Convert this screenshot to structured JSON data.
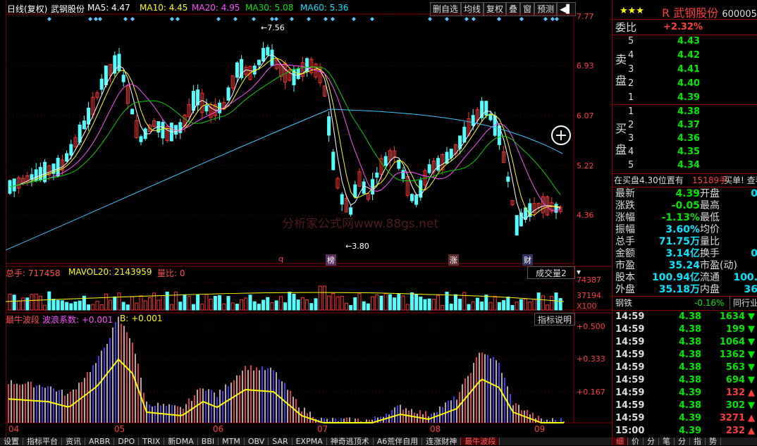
{
  "toolbar": {
    "mode": "日线(复权)",
    "stock": "武钢股份",
    "ma5": "MA5: 4.47",
    "ma10": "MA10: 4.45",
    "ma20": "MA20: 4.95",
    "ma30": "MA30: 5.08",
    "ma60": "MA60: 5.36",
    "buttons": [
      "删自选",
      "均线",
      "复权",
      "叠",
      "窗",
      "预测"
    ]
  },
  "price_axis": [
    "7.77",
    "6.93",
    "6.07",
    "5.22",
    "4.36"
  ],
  "price_annotations": {
    "high": "7.56",
    "low": "3.80"
  },
  "event_markers": [
    "q",
    "榜",
    "涨",
    "财"
  ],
  "watermark": "分析家公式网www.88gs.net",
  "volume_header": {
    "total": "总手: 717458",
    "mavol": "MAVOL20: 2143959",
    "ratio": "量比: 0",
    "selector": "成交量2"
  },
  "volume_axis": [
    "74387",
    "37194",
    "X100"
  ],
  "indicator_header": {
    "name": "最牛波段",
    "coef": "波浪系数: +0.001",
    "b": "B: +0.001",
    "help": "指标说明"
  },
  "indicator_axis": [
    "+0.500",
    "+0.333",
    "+0.167"
  ],
  "dates": [
    "04",
    "05",
    "06",
    "07",
    "08",
    "09"
  ],
  "bottom_tabs": [
    "设置",
    "指标平台",
    "资讯",
    "ARBR",
    "DPO",
    "TRIX",
    "新DMA",
    "BBI",
    "MTM",
    "OBV",
    "SAR",
    "EXPMA",
    "神奇逃顶术",
    "A6荒伴自用",
    "连涨财神",
    "最牛波段"
  ],
  "quote": {
    "title": "武钢股份",
    "code": "600005",
    "weibi_label": "委比",
    "weibi": "+2.32%",
    "sell_label": "卖\n盘",
    "buy_label": "买\n盘",
    "sells": [
      {
        "lvl": "5",
        "price": "4.43"
      },
      {
        "lvl": "4",
        "price": "4.42"
      },
      {
        "lvl": "3",
        "price": "4.41"
      },
      {
        "lvl": "2",
        "price": "4.40"
      },
      {
        "lvl": "1",
        "price": "4.39"
      }
    ],
    "buys": [
      {
        "lvl": "1",
        "price": "4.38"
      },
      {
        "lvl": "2",
        "price": "4.37"
      },
      {
        "lvl": "3",
        "price": "4.36"
      },
      {
        "lvl": "4",
        "price": "4.35"
      },
      {
        "lvl": "5",
        "price": "4.34"
      }
    ],
    "notice": "在买盘4.30位置有",
    "notice2": "15189手",
    "notice3": "买单! 查看",
    "stats": [
      {
        "l": "最新",
        "v": "4.39",
        "l2": "开盘"
      },
      {
        "l": "涨跌",
        "v": "-0.05",
        "l2": "最高"
      },
      {
        "l": "涨幅",
        "v": "-1.13%",
        "l2": "最低"
      },
      {
        "l": "振幅",
        "v": "3.60%",
        "l2": "均价"
      },
      {
        "l": "总手",
        "v": "71.75万",
        "l2": "量比"
      },
      {
        "l": "金额",
        "v": "3.14亿",
        "l2": "换手"
      },
      {
        "l": "市盈",
        "v": "35.24",
        "l2": "市盈(动)"
      },
      {
        "l": "股本",
        "v": "100.94亿",
        "l2": "流通"
      },
      {
        "l": "外盘",
        "v": "35.18万",
        "l2": "内盘"
      }
    ],
    "stat_right": [
      "0",
      "",
      "",
      "",
      "",
      "0",
      "",
      "100.",
      "36"
    ],
    "sector": "钢铁",
    "sector_chg": "-0.16%",
    "sector_btn": "同行业",
    "ticks": [
      {
        "t": "14:59",
        "p": "4.38",
        "v": "1634",
        "d": "down"
      },
      {
        "t": "14:59",
        "p": "4.38",
        "v": "199",
        "d": "down"
      },
      {
        "t": "14:59",
        "p": "4.38",
        "v": "1064",
        "d": "down"
      },
      {
        "t": "14:59",
        "p": "4.38",
        "v": "1362",
        "d": "down"
      },
      {
        "t": "14:59",
        "p": "4.38",
        "v": "563",
        "d": "down"
      },
      {
        "t": "14:59",
        "p": "4.38",
        "v": "694",
        "d": "down"
      },
      {
        "t": "14:59",
        "p": "4.39",
        "v": "132",
        "d": "up"
      },
      {
        "t": "14:59",
        "p": "4.38",
        "v": "302",
        "d": "down"
      },
      {
        "t": "14:59",
        "p": "4.39",
        "v": "3271",
        "d": "up"
      },
      {
        "t": "15:00",
        "p": "4.39",
        "v": "232",
        "d": "up"
      }
    ],
    "bottom_tabs": [
      "细",
      "价",
      "分",
      "笔",
      "分",
      "指",
      "势"
    ]
  }
}
